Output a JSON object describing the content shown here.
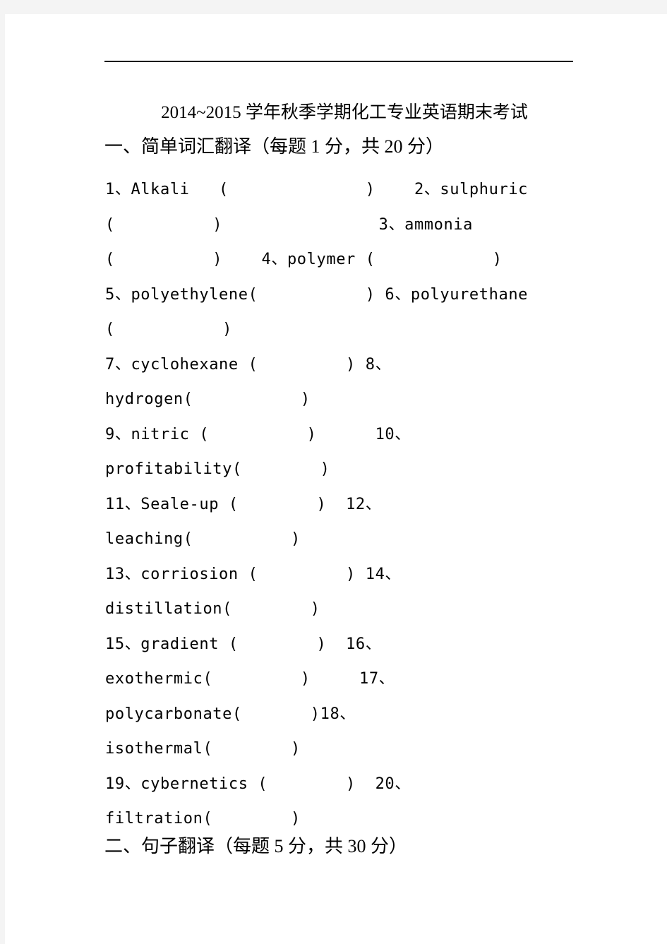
{
  "page": {
    "title_line": "2014~2015 学年秋季学期化工专业英语期末考试"
  },
  "sections": [
    {
      "id": "section-1",
      "heading": "一、简单词汇翻译（每题 1 分，共 20 分）",
      "points_per_item": 1,
      "total_points": 20,
      "item_count": 20
    },
    {
      "id": "section-2",
      "heading": "二、句子翻译（每题 5 分，共 30 分）",
      "points_per_item": 5,
      "total_points": 30
    }
  ],
  "vocabulary": {
    "items": [
      {
        "number": "1",
        "term": "Alkali"
      },
      {
        "number": "2",
        "term": "sulphuric"
      },
      {
        "number": "3",
        "term": "ammonia"
      },
      {
        "number": "4",
        "term": "polymer"
      },
      {
        "number": "5",
        "term": "polyethylene"
      },
      {
        "number": "6",
        "term": "polyurethane"
      },
      {
        "number": "7",
        "term": "cyclohexane"
      },
      {
        "number": "8",
        "term": "hydrogen"
      },
      {
        "number": "9",
        "term": "nitric"
      },
      {
        "number": "10",
        "term": "profitability"
      },
      {
        "number": "11",
        "term": "Seale-up"
      },
      {
        "number": "12",
        "term": "leaching"
      },
      {
        "number": "13",
        "term": "corriosion"
      },
      {
        "number": "14",
        "term": "distillation"
      },
      {
        "number": "15",
        "term": "gradient"
      },
      {
        "number": "16",
        "term": "exothermic"
      },
      {
        "number": "17",
        "term": "polycarbonate"
      },
      {
        "number": "18",
        "term": "isothermal"
      },
      {
        "number": "19",
        "term": "cybernetics"
      },
      {
        "number": "20",
        "term": "filtration"
      }
    ],
    "rendered_lines": [
      "1、Alkali   (              )    2、sulphuric",
      "(          )                3、ammonia",
      "(          )    4、polymer (            )",
      "5、polyethylene(           ) 6、polyurethane",
      "(           )",
      "7、cyclohexane (         ) 8、",
      "hydrogen(           )",
      "9、nitric (          )      10、",
      "profitability(        )",
      "11、Seale-up (        )  12、",
      "leaching(          )",
      "13、corriosion (         ) 14、",
      "distillation(        )",
      "15、gradient (        )  16、",
      "exothermic(         )     17、",
      "polycarbonate(       )18、",
      "isothermal(        )",
      "19、cybernetics (        )  20、",
      "filtration(        )"
    ]
  }
}
